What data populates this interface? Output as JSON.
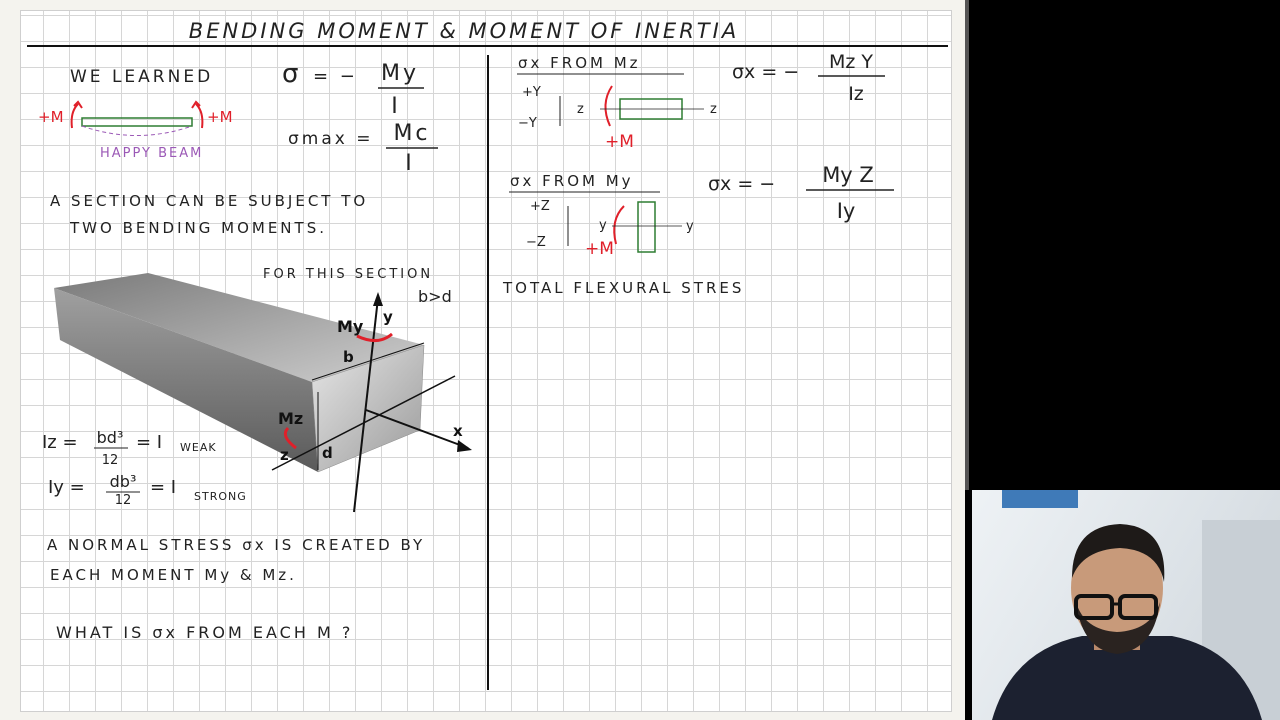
{
  "page": {
    "title": "BENDING MOMENT & MOMENT OF INERTIA"
  },
  "left": {
    "we_learned": "WE LEARNED",
    "eq1_num": "My",
    "eq1_den": "I",
    "sigma": "σ",
    "eq_minus": "= −",
    "sigma_max": "σmax =",
    "eq2_num": "Mc",
    "eq2_den": "I",
    "plus_m": "+M",
    "happy_beam": "HAPPY BEAM",
    "section_line1": "A SECTION CAN BE SUBJECT TO",
    "section_line2": "TWO BENDING MOMENTS.",
    "for_this_section": "FOR THIS SECTION",
    "b_gt_d": "b>d",
    "label_my": "My",
    "label_mz": "Mz",
    "label_y": "y",
    "label_z": "z",
    "label_x": "x",
    "label_b": "b",
    "label_d": "d",
    "iz_lhs": "Iz =",
    "iz_num": "bd³",
    "iz_den": "12",
    "iz_rhs": "= I",
    "iz_sub": "WEAK",
    "iy_lhs": "Iy =",
    "iy_num": "db³",
    "iy_den": "12",
    "iy_rhs": "= I",
    "iy_sub": "STRONG",
    "normal_line1": "A NORMAL STRESS σx IS CREATED BY",
    "normal_line2": "EACH MOMENT My & Mz.",
    "question": "WHAT IS σx FROM EACH M ?"
  },
  "right": {
    "h1": "σx FROM Mz",
    "eq_a_lhs": "σx = −",
    "eq_a_num": "Mz Y",
    "eq_a_den": "Iz",
    "plus_y": "+Y",
    "minus_y": "−Y",
    "lbl_z": "z",
    "plus_m": "+M",
    "h2": "σx FROM My",
    "eq_b_lhs": "σx = −",
    "eq_b_num": "My Z",
    "eq_b_den": "Iy",
    "plus_z": "+Z",
    "minus_z": "−Z",
    "lbl_y": "y",
    "total": "TOTAL FLEXURAL STRES"
  },
  "colors": {
    "ink": "#222222",
    "red": "#e0202a",
    "green": "#2e7d32",
    "purple": "#9b59b6"
  }
}
